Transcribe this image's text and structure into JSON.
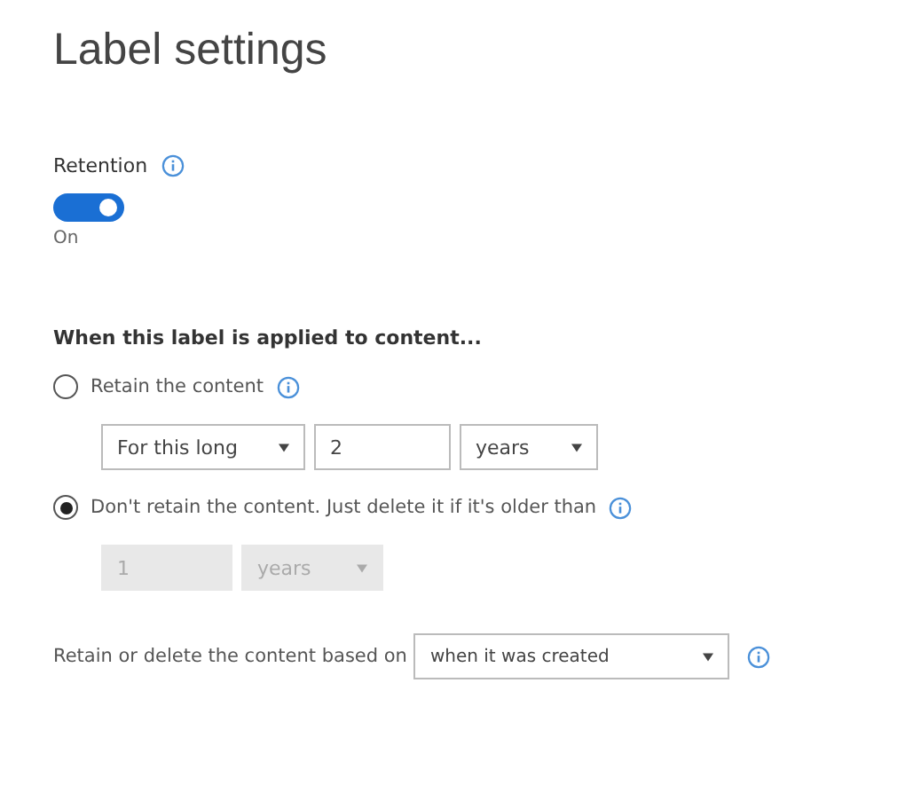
{
  "title": "Label settings",
  "retention": {
    "label": "Retention",
    "on": true,
    "state_text": "On"
  },
  "section_heading": "When this label is applied to content...",
  "options": [
    {
      "label": "Retain the content",
      "selected": false,
      "fields": [
        {
          "kind": "select",
          "value": "For this long",
          "disabled": false
        },
        {
          "kind": "input",
          "value": "2",
          "disabled": false
        },
        {
          "kind": "select",
          "value": "years",
          "disabled": false
        }
      ]
    },
    {
      "label": "Don't retain the content. Just delete it if it's older than",
      "selected": true,
      "fields": [
        {
          "kind": "input",
          "value": "1",
          "disabled": true
        },
        {
          "kind": "select",
          "value": "years",
          "disabled": true
        }
      ]
    }
  ],
  "based_on": {
    "label": "Retain or delete the content based on",
    "value": "when it was created"
  }
}
